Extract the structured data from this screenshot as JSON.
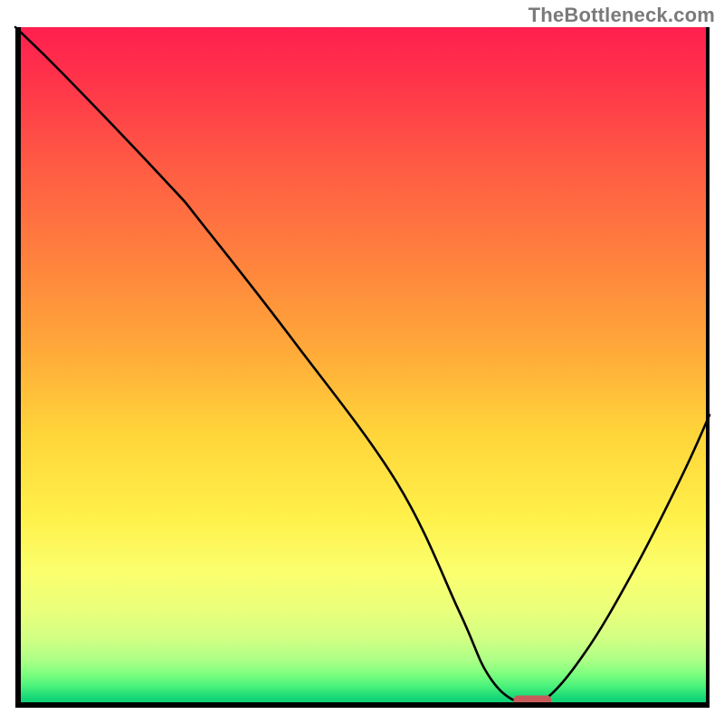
{
  "watermark": "TheBottleneck.com",
  "chart_data": {
    "type": "line",
    "title": "",
    "xlabel": "",
    "ylabel": "",
    "xlim": [
      0,
      100
    ],
    "ylim": [
      0,
      100
    ],
    "grid": false,
    "legend": false,
    "series": [
      {
        "name": "bottleneck-curve",
        "x": [
          0,
          7,
          22,
          27,
          40,
          55,
          64,
          68,
          72,
          76,
          82,
          89,
          96,
          100
        ],
        "values": [
          100,
          93,
          77,
          71,
          54,
          33,
          14,
          5,
          1,
          1,
          8,
          20,
          34,
          43
        ]
      }
    ],
    "optimum_marker": {
      "x": 74.5,
      "y": 1,
      "color": "#c85a5a",
      "label": "optimal-zone"
    },
    "background_gradient": {
      "direction": "vertical",
      "stops": [
        {
          "pos": 0.0,
          "color": "#ff1f4f"
        },
        {
          "pos": 0.35,
          "color": "#ff843d"
        },
        {
          "pos": 0.72,
          "color": "#fff04a"
        },
        {
          "pos": 0.95,
          "color": "#7eff7f"
        },
        {
          "pos": 1.0,
          "color": "#04c471"
        }
      ]
    }
  }
}
